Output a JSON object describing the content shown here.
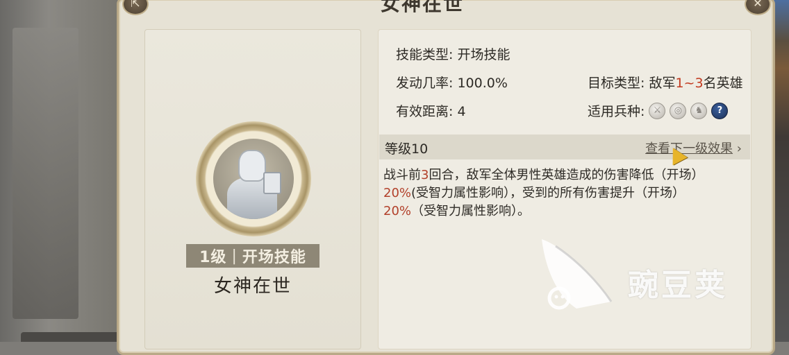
{
  "dialog": {
    "title": "女神在世"
  },
  "skill": {
    "level_label": "1级",
    "type_label": "开场技能",
    "name": "女神在世"
  },
  "stats": {
    "skill_type": "技能类型: 开场技能",
    "trigger_rate": "发动几率: 100.0%",
    "range": "有效距离: 4",
    "target_prefix": "目标类型: 敌军",
    "target_count": "1~3",
    "target_suffix": "名英雄",
    "troop_label": "适用兵种:"
  },
  "troop_icons": [
    "sword-icon",
    "shield-icon",
    "horse-icon",
    "help-icon"
  ],
  "troop_help_glyph": "?",
  "level_section": {
    "level_text": "等级10",
    "next_prefix": "查看下",
    "next_underlined": "一级效果",
    "next_arrow": "›"
  },
  "description": {
    "p1_a": "战斗前",
    "p1_num": "3",
    "p1_b": "回合，敌军全体男性英雄造成的伤害降低（开场）",
    "p2_pct": "20%",
    "p2_b": "(受智力属性影响），受到的所有伤害提升（开场）",
    "p3_pct": "20%",
    "p3_b": "（受智力属性影响）。"
  },
  "watermark": {
    "text": "豌豆荚"
  },
  "colors": {
    "highlight": "#c23a1f",
    "panel_bg": "#e6e2d5",
    "badge_bg": "#8e8776"
  }
}
